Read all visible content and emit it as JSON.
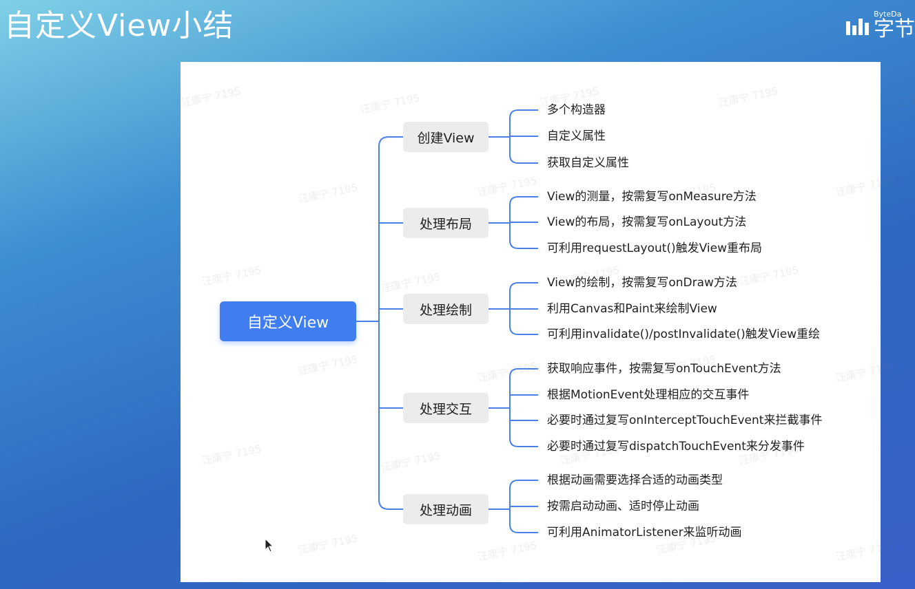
{
  "slide": {
    "title": "自定义View小结"
  },
  "brand": {
    "name_en": "ByteDa",
    "name_cn": "字节"
  },
  "watermark": "汪康宁 7195",
  "diagram": {
    "root": "自定义View",
    "branches": [
      {
        "label": "创建View",
        "items": [
          "多个构造器",
          "自定义属性",
          "获取自定义属性"
        ]
      },
      {
        "label": "处理布局",
        "items": [
          "View的测量，按需复写onMeasure方法",
          "View的布局，按需复写onLayout方法",
          "可利用requestLayout()触发View重布局"
        ]
      },
      {
        "label": "处理绘制",
        "items": [
          "View的绘制，按需复写onDraw方法",
          "利用Canvas和Paint来绘制View",
          "可利用invalidate()/postInvalidate()触发View重绘"
        ]
      },
      {
        "label": "处理交互",
        "items": [
          "获取响应事件，按需复写onTouchEvent方法",
          "根据MotionEvent处理相应的交互事件",
          "必要时通过复写onInterceptTouchEvent来拦截事件",
          "必要时通过复写dispatchTouchEvent来分发事件"
        ]
      },
      {
        "label": "处理动画",
        "items": [
          "根据动画需要选择合适的动画类型",
          "按需启动动画、适时停止动画",
          "可利用AnimatorListener来监听动画"
        ]
      }
    ],
    "colors": {
      "line": "#4a7fe8",
      "root_bg": "#3f7df0",
      "branch_bg": "#ececec"
    }
  }
}
